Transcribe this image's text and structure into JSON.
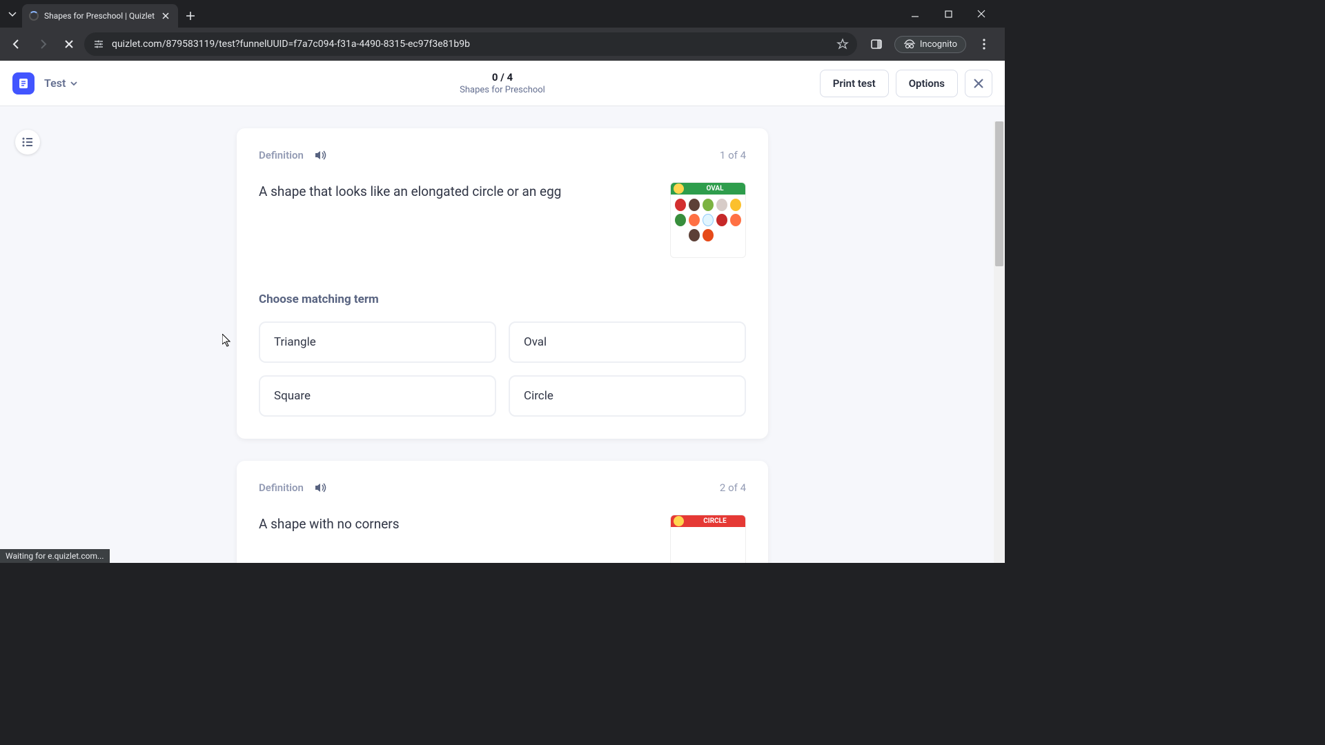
{
  "browser": {
    "tab_title": "Shapes for Preschool | Quizlet",
    "url": "quizlet.com/879583119/test?funnelUUID=f7a7c094-f31a-4490-8315-ec97f3e81b9b",
    "incognito_label": "Incognito",
    "status_text": "Waiting for e.quizlet.com..."
  },
  "header": {
    "mode_label": "Test",
    "progress": "0 / 4",
    "set_title": "Shapes for Preschool",
    "print_label": "Print test",
    "options_label": "Options"
  },
  "questions": [
    {
      "label": "Definition",
      "counter": "1 of 4",
      "text": "A shape that looks like an elongated circle or an egg",
      "image_banner": "OVAL",
      "choose_label": "Choose matching term",
      "options": [
        "Triangle",
        "Oval",
        "Square",
        "Circle"
      ]
    },
    {
      "label": "Definition",
      "counter": "2 of 4",
      "text": "A shape with no corners",
      "image_banner": "CIRCLE"
    }
  ]
}
